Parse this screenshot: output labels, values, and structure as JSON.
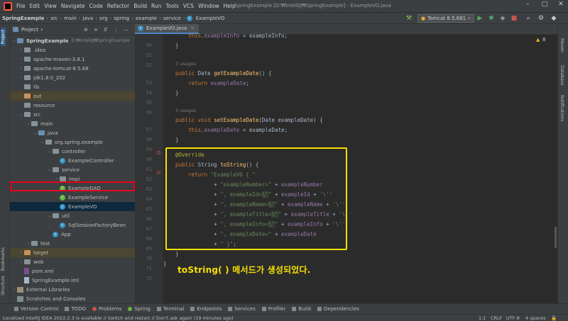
{
  "menubar": {
    "items": [
      "File",
      "Edit",
      "View",
      "Navigate",
      "Code",
      "Refactor",
      "Build",
      "Run",
      "Tools",
      "VCS",
      "Window",
      "Help"
    ],
    "title": "SpringExample [D:₩IntelliJ₩SpringExample] - ExampleVO.java"
  },
  "navbar": {
    "crumbs": [
      "SpringExample",
      "src",
      "main",
      "java",
      "org",
      "spring",
      "example",
      "service",
      "ExampleVO"
    ],
    "run_config": "Tomcat 8.5.681"
  },
  "left_strip": {
    "project": "Project",
    "bookmarks": "Bookmarks",
    "structure": "Structure"
  },
  "right_strip": {
    "maven": "Maven",
    "database": "Database",
    "notifications": "Notifications"
  },
  "project_panel": {
    "title": "Project",
    "tree": [
      {
        "label": "SpringExample",
        "extra": "D:₩IntelliJ₩SpringExample"
      },
      {
        "label": ".idea"
      },
      {
        "label": "apache-maven-3.8.1"
      },
      {
        "label": "apache-tomcat-8.5.68"
      },
      {
        "label": "jdk1.8.0_202"
      },
      {
        "label": "lib"
      },
      {
        "label": "out"
      },
      {
        "label": "resource"
      },
      {
        "label": "src"
      },
      {
        "label": "main"
      },
      {
        "label": "java"
      },
      {
        "label": "org.spring.example"
      },
      {
        "label": "controller"
      },
      {
        "label": "ExampleController"
      },
      {
        "label": "service"
      },
      {
        "label": "impl"
      },
      {
        "label": "ExampleDAO"
      },
      {
        "label": "ExampleService"
      },
      {
        "label": "ExampleVO"
      },
      {
        "label": "util"
      },
      {
        "label": "SqlSessionFactoryBean"
      },
      {
        "label": "App"
      },
      {
        "label": "test"
      },
      {
        "label": "target"
      },
      {
        "label": "web"
      },
      {
        "label": "pom.xml"
      },
      {
        "label": "SpringExample.iml"
      },
      {
        "label": "External Libraries"
      },
      {
        "label": "Scratches and Consoles"
      }
    ]
  },
  "editor": {
    "tab": "ExampleVO.java",
    "inspection": "8",
    "usages": "3 usages",
    "line_numbers": [
      "50",
      "51",
      "52",
      "53",
      "54",
      "55",
      "56",
      "57",
      "58",
      "59",
      "60",
      "61",
      "62",
      "63",
      "64",
      "65",
      "66",
      "67",
      "68",
      "69",
      "70",
      "71",
      "72"
    ],
    "code": {
      "l50b": "this",
      "l50c": ".",
      "l50d": "exampleInfo",
      "l50e": " = exampleInfo;",
      "l51": "}",
      "l53a": "public ",
      "l53b": "Date ",
      "l53c": "getExampleDate",
      "l53d": "() {",
      "l54a": "return ",
      "l54b": "exampleDate",
      "l54c": ";",
      "l55": "}",
      "l57a": "public void ",
      "l57b": "setExampleDate",
      "l57c": "(Date exampleDate) {",
      "l58a": "this",
      "l58b": ".",
      "l58c": "exampleDate",
      "l58d": " = exampleDate;",
      "l59": "}",
      "l61": "@Override",
      "l62a": "public ",
      "l62b": "String ",
      "l62c": "toString",
      "l62d": "() {",
      "l63a": "return ",
      "l63b": "\"ExampleVO { \"",
      "l64a": "+ ",
      "l64b": "\"exampleNumber=\"",
      "l64c": " + ",
      "l64d": "exampleNumber",
      "l65a": "+ ",
      "l65b": "\", exampleId=",
      "l65esc": "\\'",
      "l65c": "\"",
      "l65d": " + ",
      "l65e": "exampleId",
      "l65f": " + ",
      "l65g": "'\\''",
      "l66a": "+ ",
      "l66b": "\", exampleName=",
      "l66esc": "\\'",
      "l66c": "\"",
      "l66d": " + ",
      "l66e": "exampleName",
      "l66f": " + ",
      "l66g": "'\\''",
      "l67a": "+ ",
      "l67b": "\", exampleTitle=",
      "l67esc": "\\'",
      "l67c": "\"",
      "l67d": " + ",
      "l67e": "exampleTitle",
      "l67f": " + ",
      "l67g": "'\\''",
      "l68a": "+ ",
      "l68b": "\", exampleInfo=",
      "l68esc": "\\'",
      "l68c": "\"",
      "l68d": " + ",
      "l68e": "exampleInfo",
      "l68f": " + ",
      "l68g": "'\\''",
      "l69a": "+ ",
      "l69b": "\", exampleDate=\"",
      "l69c": " + ",
      "l69d": "exampleDate",
      "l70a": "+ ",
      "l70b": "\" }\"",
      "l70c": ";",
      "l71": "}",
      "l72": "}"
    }
  },
  "caption": "toString( ) 메서드가 생성되었다.",
  "bottom_tools": [
    "Version Control",
    "TODO",
    "Problems",
    "Spring",
    "Terminal",
    "Endpoints",
    "Services",
    "Profiler",
    "Build",
    "Dependencies"
  ],
  "status": {
    "message": "Localized IntelliJ IDEA 2022.2.3 is available // Switch and restart // Don't ask again (19 minutes ago)",
    "pos": "1:1",
    "eol": "CRLF",
    "enc": "UTF-8",
    "indent": "4 spaces"
  }
}
